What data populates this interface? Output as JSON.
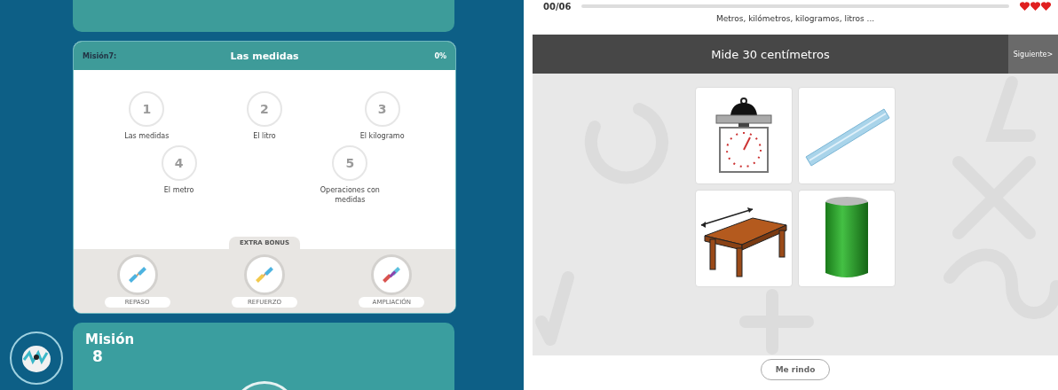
{
  "mission_card": {
    "label": "Misión7:",
    "title": "Las medidas",
    "percent": "0%",
    "steps": [
      {
        "number": "1",
        "label": "Las medidas"
      },
      {
        "number": "2",
        "label": "El litro"
      },
      {
        "number": "3",
        "label": "El kilogramo"
      },
      {
        "number": "4",
        "label": "El metro"
      },
      {
        "number": "5",
        "label": "Operaciones con medidas"
      }
    ],
    "bonus_title": "EXTRA BONUS",
    "bonus": [
      {
        "kind": "basic",
        "label": "REPASO"
      },
      {
        "kind": "medium",
        "label": "REFUERZO"
      },
      {
        "kind": "colorful",
        "label": "AMPLIACIÓN"
      }
    ]
  },
  "next_mission": {
    "label": "Misión",
    "number": "8"
  },
  "exercise": {
    "counter": "00/06",
    "progress": {
      "level": 0
    },
    "subtitle": "Metros, kilómetros, kilogramos, litros ...",
    "question": "Mide 30 centímetros",
    "next_button": "Siguiente>",
    "options": [
      {
        "kind": "scale"
      },
      {
        "kind": "ruler"
      },
      {
        "kind": "table"
      },
      {
        "kind": "can"
      }
    ],
    "give_up_button": "Me rindo"
  }
}
